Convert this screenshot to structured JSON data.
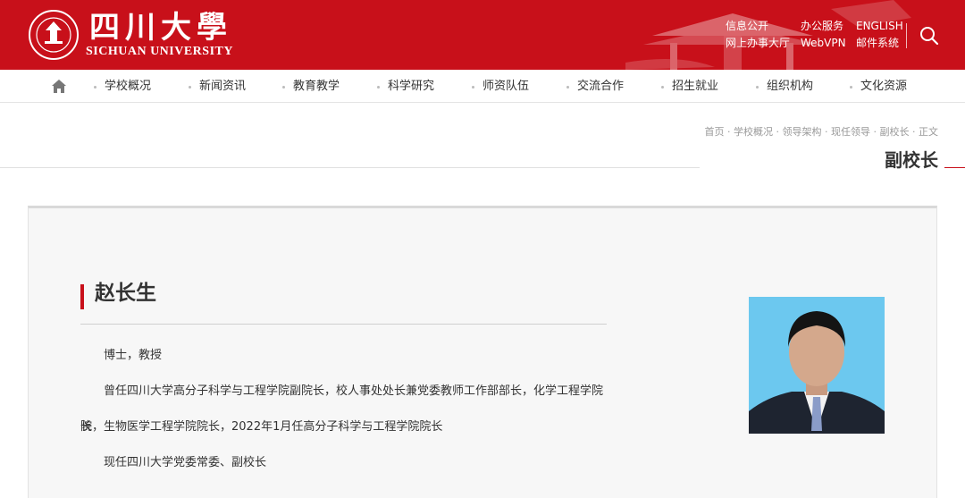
{
  "header": {
    "brand_cn": "四川大學",
    "brand_en": "SICHUAN UNIVERSITY",
    "links": {
      "info": "信息公开",
      "office": "办公服务",
      "english": "ENGLISH",
      "online": "网上办事大厅",
      "vpn": "WebVPN",
      "mail": "邮件系统"
    }
  },
  "nav": {
    "items": [
      "学校概况",
      "新闻资讯",
      "教育教学",
      "科学研究",
      "师资队伍",
      "交流合作",
      "招生就业",
      "组织机构",
      "文化资源"
    ]
  },
  "breadcrumb": "首页 · 学校概况 · 领导架构 · 现任领导 · 副校长 · 正文",
  "section_title": "副校长",
  "profile": {
    "name": "赵长生",
    "title_line": "博士，教授",
    "career_part1": "曾任四川大学高分子科学与工程学院副院长，校人事处处长兼党委教师工作部部长，化学工程学院院",
    "career_part2": "长，生物医学工程学院院长，2022年1月任高分子科学与工程学院院长",
    "current": "现任四川大学党委常委、副校长"
  },
  "colors": {
    "brand_red": "#c8101a",
    "photo_bg": "#6cc8ef"
  }
}
